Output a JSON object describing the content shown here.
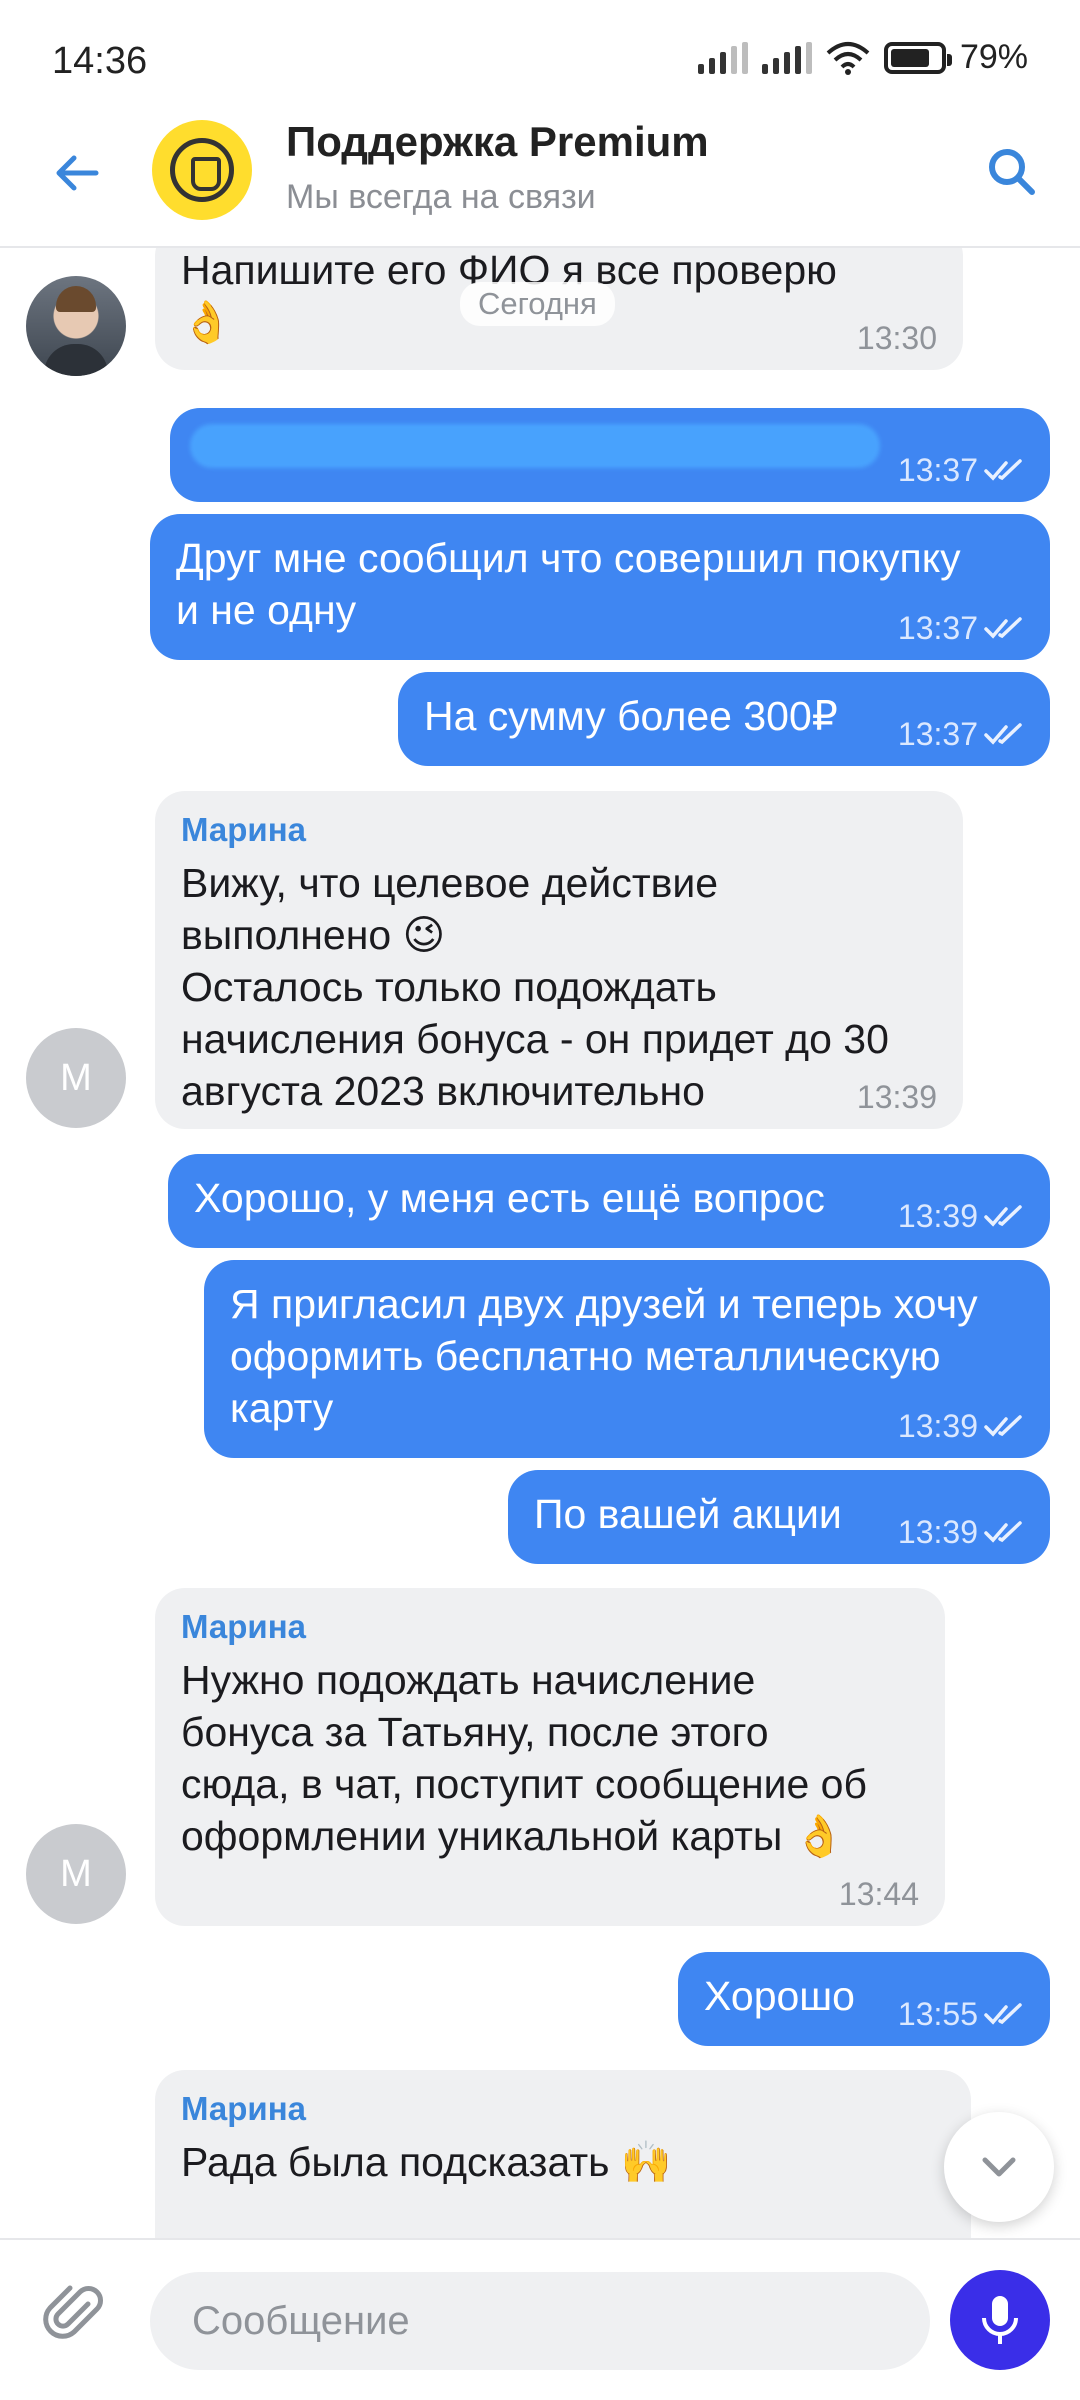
{
  "status_bar": {
    "time": "14:36",
    "battery": "79%",
    "battery_level": 0.79
  },
  "header": {
    "title": "Поддержка Premium",
    "subtitle": "Мы всегда на связи"
  },
  "date_divider": "Сегодня",
  "messages": [
    {
      "direction": "in",
      "text": "Напишите его ФИО я все проверю\n👌",
      "time": "13:30",
      "avatar": "photo"
    },
    {
      "direction": "out",
      "text": "",
      "time": "13:37",
      "redacted": true
    },
    {
      "direction": "out",
      "text": "Друг мне сообщил что совершил покупку\nи не одну",
      "time": "13:37"
    },
    {
      "direction": "out",
      "text": "На сумму более 300₽",
      "time": "13:37"
    },
    {
      "direction": "in",
      "sender": "Марина",
      "text": "Вижу, что целевое действие\nвыполнено 😉\nОсталось только подождать\nначисления бонуса - он придет до 30\nавгуста 2023 включительно",
      "time": "13:39",
      "avatar": "М"
    },
    {
      "direction": "out",
      "text": "Хорошо, у меня есть ещё вопрос",
      "time": "13:39"
    },
    {
      "direction": "out",
      "text": "Я пригласил двух друзей и теперь хочу\nоформить бесплатно металлическую\nкарту",
      "time": "13:39"
    },
    {
      "direction": "out",
      "text": "По вашей акции",
      "time": "13:39"
    },
    {
      "direction": "in",
      "sender": "Марина",
      "text": "Нужно подождать начисление\nбонуса за Татьяну, после этого\nсюда, в чат, поступит сообщение об\nоформлении уникальной карты 👌",
      "time": "13:44",
      "avatar": "М"
    },
    {
      "direction": "out",
      "text": "Хорошо",
      "time": "13:55"
    },
    {
      "direction": "in",
      "sender": "Марина",
      "text": "Рада была подсказать 🙌",
      "time": "",
      "avatar": ""
    }
  ],
  "composer": {
    "placeholder": "Сообщение"
  },
  "colors": {
    "accent": "#3f86f2",
    "incoming": "#eff0f2",
    "mic": "#3a2ee8",
    "brand_yellow": "#ffdd2d"
  },
  "icons": [
    "back-arrow-icon",
    "search-icon",
    "double-check-icon",
    "chevron-down-icon",
    "paperclip-icon",
    "microphone-icon"
  ]
}
